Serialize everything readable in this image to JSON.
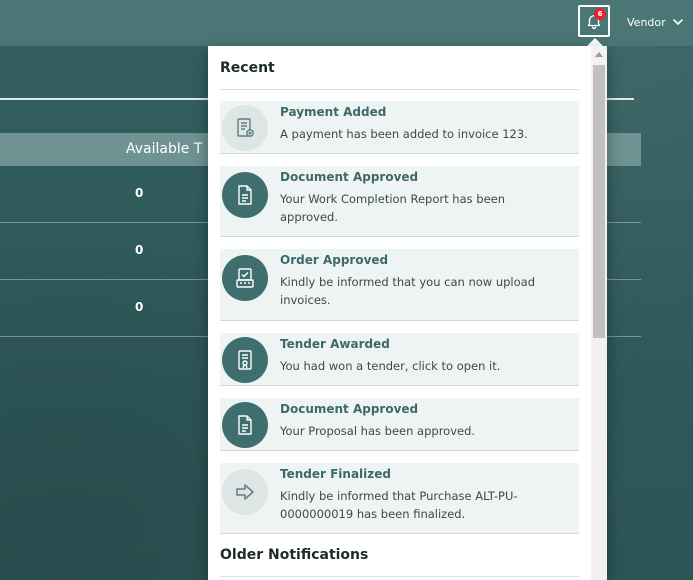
{
  "header": {
    "notification_count": "6",
    "user_label": "Vendor"
  },
  "table": {
    "header_label": "Available T",
    "rows": [
      "0",
      "0",
      "0"
    ]
  },
  "notifications": {
    "recent_title": "Recent",
    "older_title": "Older Notifications",
    "items": [
      {
        "title": "Payment Added",
        "message": "A payment has been added to invoice 123.",
        "icon": "payment-receipt-icon"
      },
      {
        "title": "Document Approved",
        "message": "Your Work Completion Report has been approved.",
        "icon": "document-icon"
      },
      {
        "title": "Order Approved",
        "message": "Kindly be informed that you can now upload invoices.",
        "icon": "order-approved-icon"
      },
      {
        "title": "Tender Awarded",
        "message": "You had won a tender, click to open it.",
        "icon": "certificate-icon"
      },
      {
        "title": "Document Approved",
        "message": "Your Proposal has been approved.",
        "icon": "document-icon"
      },
      {
        "title": "Tender Finalized",
        "message": "Kindly be informed that Purchase ALT-PU-0000000019 has been finalized.",
        "icon": "arrow-right-icon"
      }
    ]
  },
  "colors": {
    "primary": "#3e6e6d",
    "badge": "#e0262b"
  }
}
